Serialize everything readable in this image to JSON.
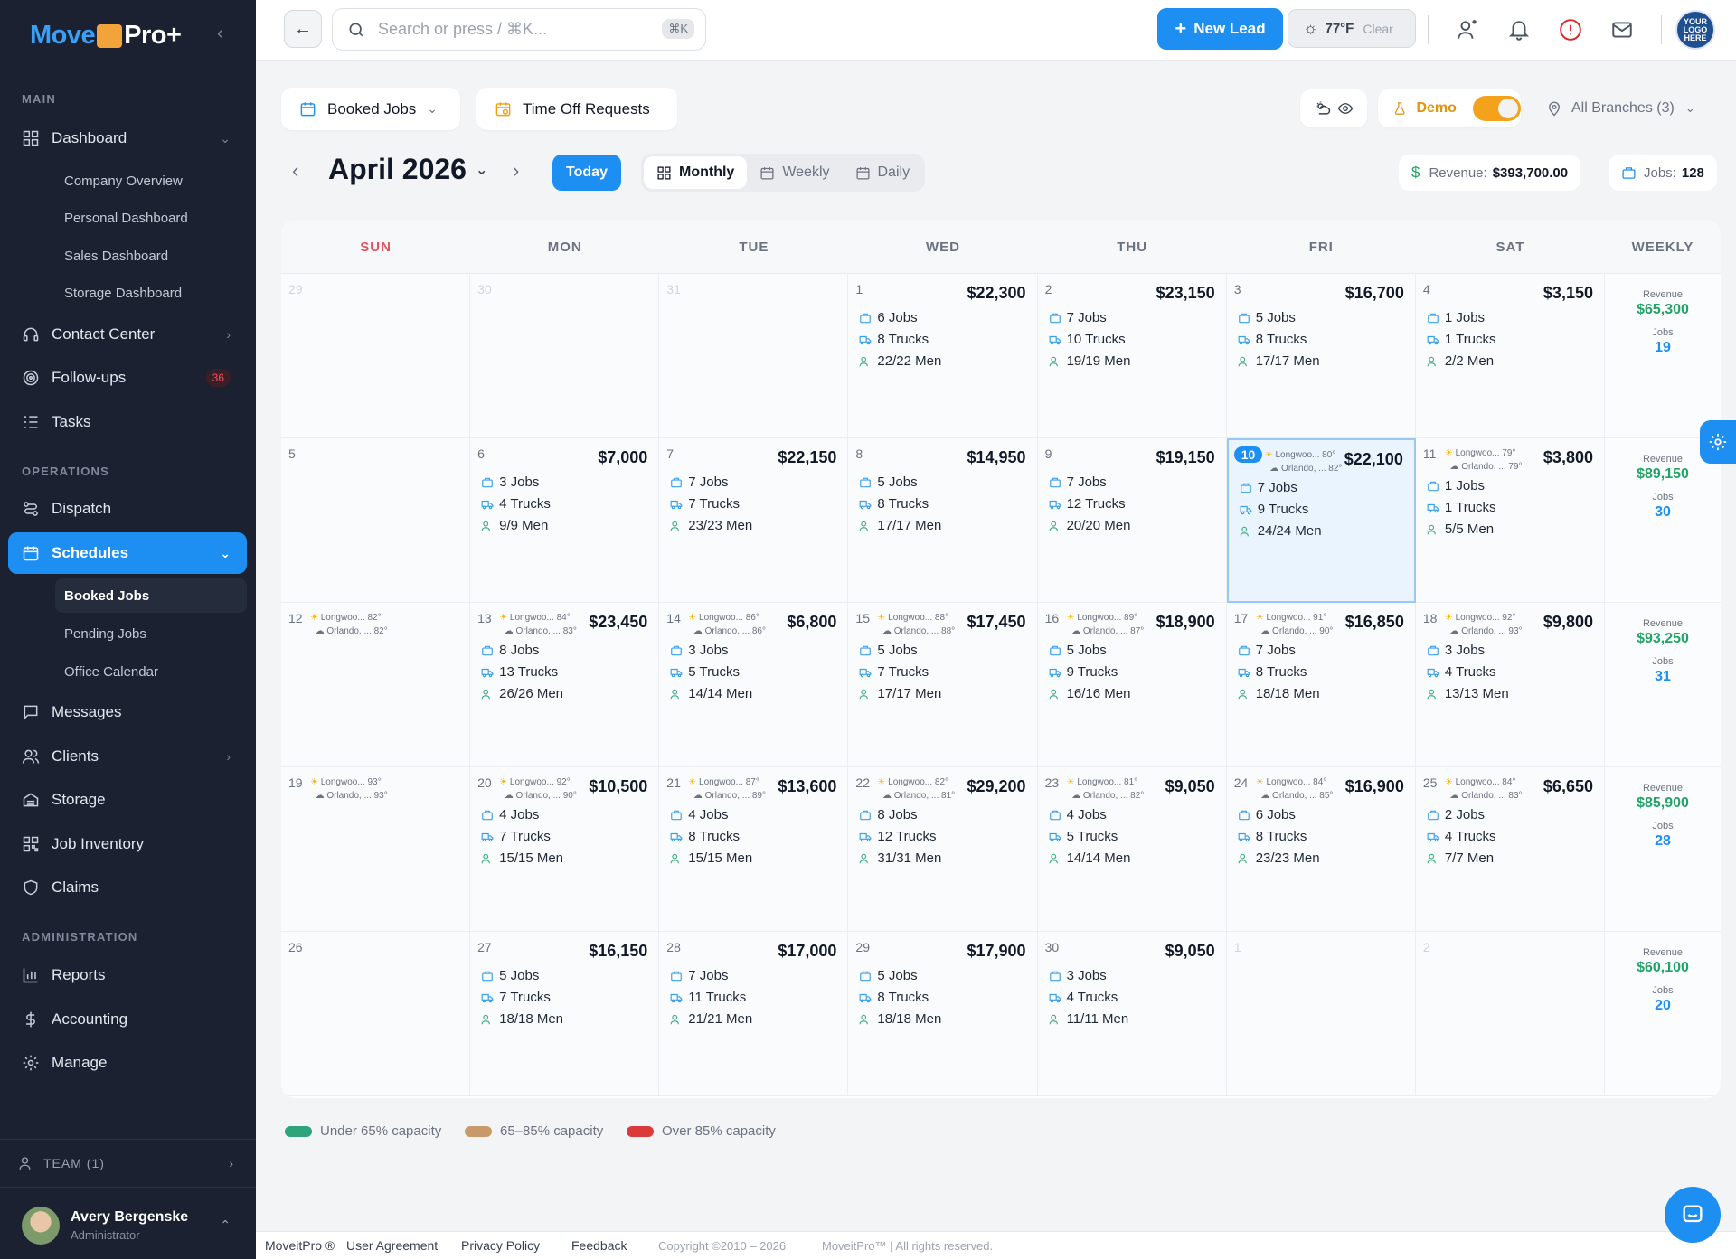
{
  "brand": {
    "logo_part1": "Move",
    "logo_part2": "Pro+",
    "collapse_icon": "chevron-left-icon"
  },
  "sidebar": {
    "sections": {
      "main": "MAIN",
      "operations": "OPERATIONS",
      "administration": "ADMINISTRATION"
    },
    "dashboard": {
      "label": "Dashboard",
      "children": [
        "Company Overview",
        "Personal Dashboard",
        "Sales Dashboard",
        "Storage Dashboard"
      ]
    },
    "contact_center": "Contact Center",
    "followups": {
      "label": "Follow-ups",
      "badge": "36"
    },
    "tasks": "Tasks",
    "dispatch": "Dispatch",
    "schedules": {
      "label": "Schedules",
      "children": [
        "Booked Jobs",
        "Pending Jobs",
        "Office Calendar"
      ]
    },
    "messages": "Messages",
    "clients": "Clients",
    "storage": "Storage",
    "job_inventory": "Job Inventory",
    "claims": "Claims",
    "reports": "Reports",
    "accounting": "Accounting",
    "manage": "Manage",
    "team": "TEAM (1)",
    "user": {
      "name": "Avery Bergenske",
      "role": "Administrator"
    }
  },
  "topbar": {
    "search_placeholder": "Search or press / ⌘K...",
    "search_kbd": "⌘K",
    "new_lead": "New Lead",
    "weather_temp": "77°F",
    "weather_cond": "Clear",
    "logo_text": "YOUR LOGO HERE"
  },
  "toolbar": {
    "booked_jobs": "Booked Jobs",
    "time_off": "Time Off Requests",
    "demo": "Demo",
    "branches": "All Branches (3)",
    "month": "April 2026",
    "today": "Today",
    "views": [
      "Monthly",
      "Weekly",
      "Daily"
    ],
    "revenue_label": "Revenue:",
    "revenue_value": "$393,700.00",
    "jobs_label": "Jobs:",
    "jobs_value": "128"
  },
  "calendar": {
    "day_names": [
      "SUN",
      "MON",
      "TUE",
      "WED",
      "THU",
      "FRI",
      "SAT"
    ],
    "weekly_label": "WEEKLY",
    "revenue_label": "Revenue",
    "jobs_label": "Jobs",
    "weeks": [
      {
        "weekly": {
          "revenue": "$65,300",
          "jobs": "19"
        },
        "days": [
          {
            "d": "29",
            "muted": true
          },
          {
            "d": "30",
            "muted": true
          },
          {
            "d": "31",
            "muted": true
          },
          {
            "d": "1",
            "amt": "$22,300",
            "jobs": "6 Jobs",
            "trucks": "8 Trucks",
            "men": "22/22 Men"
          },
          {
            "d": "2",
            "amt": "$23,150",
            "jobs": "7 Jobs",
            "trucks": "10 Trucks",
            "men": "19/19 Men"
          },
          {
            "d": "3",
            "amt": "$16,700",
            "jobs": "5 Jobs",
            "trucks": "8 Trucks",
            "men": "17/17 Men"
          },
          {
            "d": "4",
            "amt": "$3,150",
            "jobs": "1 Jobs",
            "trucks": "1 Trucks",
            "men": "2/2 Men"
          }
        ]
      },
      {
        "weekly": {
          "revenue": "$89,150",
          "jobs": "30"
        },
        "days": [
          {
            "d": "5"
          },
          {
            "d": "6",
            "amt": "$7,000",
            "jobs": "3 Jobs",
            "trucks": "4 Trucks",
            "men": "9/9 Men"
          },
          {
            "d": "7",
            "amt": "$22,150",
            "jobs": "7 Jobs",
            "trucks": "7 Trucks",
            "men": "23/23 Men"
          },
          {
            "d": "8",
            "amt": "$14,950",
            "jobs": "5 Jobs",
            "trucks": "8 Trucks",
            "men": "17/17 Men"
          },
          {
            "d": "9",
            "amt": "$19,150",
            "jobs": "7 Jobs",
            "trucks": "12 Trucks",
            "men": "20/20 Men"
          },
          {
            "d": "10",
            "today": true,
            "amt": "$22,100",
            "wx1": "Longwoo... 80°",
            "wx2": "Orlando, ... 82°",
            "jobs": "7 Jobs",
            "trucks": "9 Trucks",
            "men": "24/24 Men"
          },
          {
            "d": "11",
            "amt": "$3,800",
            "wx1": "Longwoo... 79°",
            "wx2": "Orlando, ... 79°",
            "jobs": "1 Jobs",
            "trucks": "1 Trucks",
            "men": "5/5 Men"
          }
        ]
      },
      {
        "weekly": {
          "revenue": "$93,250",
          "jobs": "31"
        },
        "days": [
          {
            "d": "12",
            "wx1": "Longwoo... 82°",
            "wx2": "Orlando, ... 82°"
          },
          {
            "d": "13",
            "amt": "$23,450",
            "wx1": "Longwoo... 84°",
            "wx2": "Orlando, ... 83°",
            "jobs": "8 Jobs",
            "trucks": "13 Trucks",
            "men": "26/26 Men"
          },
          {
            "d": "14",
            "amt": "$6,800",
            "wx1": "Longwoo... 86°",
            "wx2": "Orlando, ... 86°",
            "jobs": "3 Jobs",
            "trucks": "5 Trucks",
            "men": "14/14 Men"
          },
          {
            "d": "15",
            "amt": "$17,450",
            "wx1": "Longwoo... 88°",
            "wx2": "Orlando, ... 88°",
            "jobs": "5 Jobs",
            "trucks": "7 Trucks",
            "men": "17/17 Men"
          },
          {
            "d": "16",
            "amt": "$18,900",
            "wx1": "Longwoo... 89°",
            "wx2": "Orlando, ... 87°",
            "jobs": "5 Jobs",
            "trucks": "9 Trucks",
            "men": "16/16 Men"
          },
          {
            "d": "17",
            "amt": "$16,850",
            "wx1": "Longwoo... 91°",
            "wx2": "Orlando, ... 90°",
            "jobs": "7 Jobs",
            "trucks": "8 Trucks",
            "men": "18/18 Men"
          },
          {
            "d": "18",
            "amt": "$9,800",
            "wx1": "Longwoo... 92°",
            "wx2": "Orlando, ... 93°",
            "jobs": "3 Jobs",
            "trucks": "4 Trucks",
            "men": "13/13 Men"
          }
        ]
      },
      {
        "weekly": {
          "revenue": "$85,900",
          "jobs": "28"
        },
        "days": [
          {
            "d": "19",
            "wx1": "Longwoo... 93°",
            "wx2": "Orlando, ... 93°"
          },
          {
            "d": "20",
            "amt": "$10,500",
            "wx1": "Longwoo... 92°",
            "wx2": "Orlando, ... 90°",
            "jobs": "4 Jobs",
            "trucks": "7 Trucks",
            "men": "15/15 Men"
          },
          {
            "d": "21",
            "amt": "$13,600",
            "wx1": "Longwoo... 87°",
            "wx2": "Orlando, ... 89°",
            "jobs": "4 Jobs",
            "trucks": "8 Trucks",
            "men": "15/15 Men"
          },
          {
            "d": "22",
            "amt": "$29,200",
            "wx1": "Longwoo... 82°",
            "wx2": "Orlando, ... 81°",
            "jobs": "8 Jobs",
            "trucks": "12 Trucks",
            "men": "31/31 Men"
          },
          {
            "d": "23",
            "amt": "$9,050",
            "wx1": "Longwoo... 81°",
            "wx2": "Orlando, ... 82°",
            "jobs": "4 Jobs",
            "trucks": "5 Trucks",
            "men": "14/14 Men"
          },
          {
            "d": "24",
            "amt": "$16,900",
            "wx1": "Longwoo... 84°",
            "wx2": "Orlando, ... 85°",
            "jobs": "6 Jobs",
            "trucks": "8 Trucks",
            "men": "23/23 Men"
          },
          {
            "d": "25",
            "amt": "$6,650",
            "wx1": "Longwoo... 84°",
            "wx2": "Orlando, ... 83°",
            "jobs": "2 Jobs",
            "trucks": "4 Trucks",
            "men": "7/7 Men"
          }
        ]
      },
      {
        "weekly": {
          "revenue": "$60,100",
          "jobs": "20"
        },
        "days": [
          {
            "d": "26"
          },
          {
            "d": "27",
            "amt": "$16,150",
            "jobs": "5 Jobs",
            "trucks": "7 Trucks",
            "men": "18/18 Men"
          },
          {
            "d": "28",
            "amt": "$17,000",
            "jobs": "7 Jobs",
            "trucks": "11 Trucks",
            "men": "21/21 Men"
          },
          {
            "d": "29",
            "amt": "$17,900",
            "jobs": "5 Jobs",
            "trucks": "8 Trucks",
            "men": "18/18 Men"
          },
          {
            "d": "30",
            "amt": "$9,050",
            "jobs": "3 Jobs",
            "trucks": "4 Trucks",
            "men": "11/11 Men"
          },
          {
            "d": "1",
            "muted": true
          },
          {
            "d": "2",
            "muted": true
          }
        ]
      }
    ]
  },
  "legend": [
    {
      "label": "Under 65% capacity",
      "color": "#2fa37a"
    },
    {
      "label": "65–85% capacity",
      "color": "#c89a6a"
    },
    {
      "label": "Over 85% capacity",
      "color": "#dc3a3a"
    }
  ],
  "footer": {
    "brand": "MoveitPro ®",
    "agreement": "User Agreement",
    "privacy": "Privacy Policy",
    "feedback": "Feedback",
    "copyright": "Copyright ©2010 – 2026",
    "rights": "MoveitPro™ | All rights reserved."
  }
}
